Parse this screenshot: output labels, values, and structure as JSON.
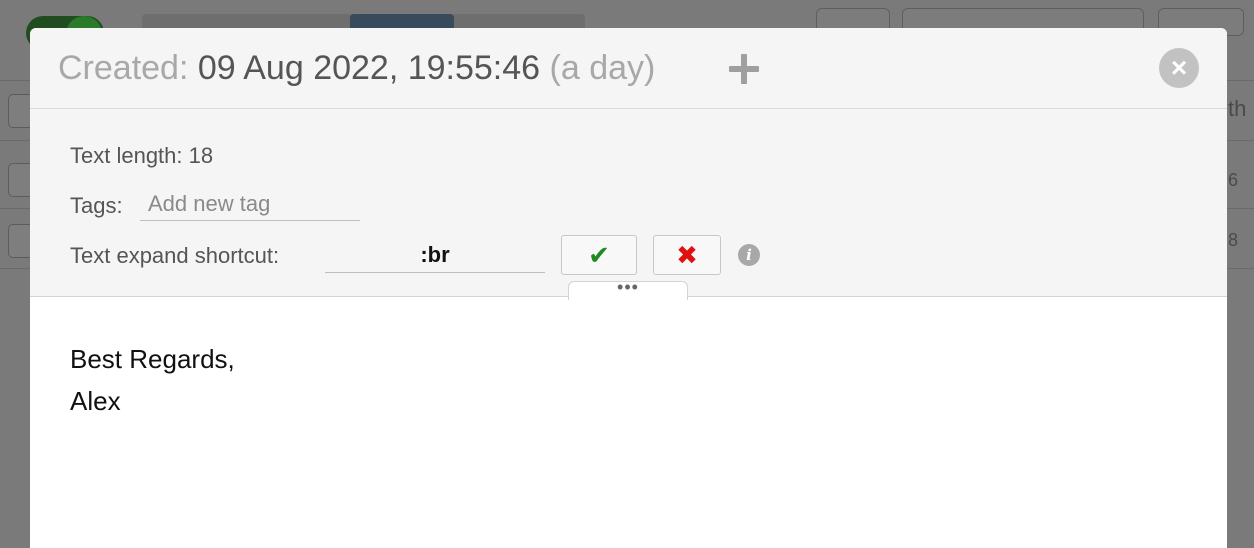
{
  "background": {
    "right_fragments": [
      "th",
      "6",
      "8"
    ]
  },
  "modal": {
    "created_label": "Created:",
    "created_value": "09 Aug 2022, 19:55:46",
    "created_relative": "(a day)",
    "add_icon": "plus-icon",
    "close_icon": "close-icon"
  },
  "info": {
    "text_length_label": "Text length: 18",
    "tags_label": "Tags:",
    "tags_placeholder": "Add new tag",
    "shortcut_label": "Text expand shortcut:",
    "shortcut_value": ":br",
    "confirm_symbol": "✔",
    "cancel_symbol": "✖",
    "info_symbol": "i",
    "more_symbol": "•••"
  },
  "content": {
    "lines": [
      "Best Regards,",
      "Alex"
    ]
  },
  "colors": {
    "confirm": "#1f8a1f",
    "cancel": "#e01010",
    "overlay": "#7a7a7a"
  }
}
